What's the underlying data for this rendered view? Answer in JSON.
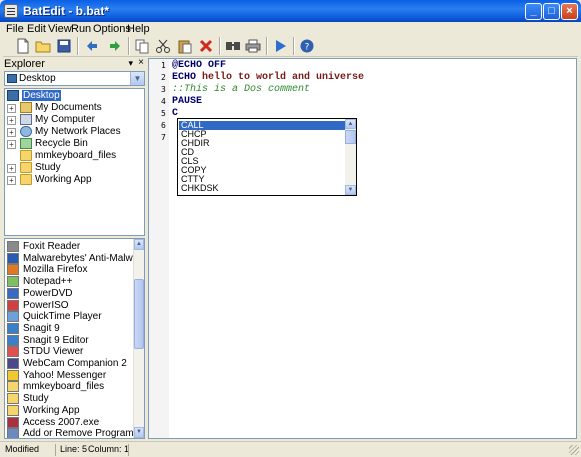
{
  "window": {
    "title": "BatEdit - b.bat*"
  },
  "menu": [
    "File",
    "Edit",
    "View",
    "Run",
    "Options",
    "Help"
  ],
  "toolbar": {
    "buttons": [
      "new-file-icon",
      "open-folder-icon",
      "save-icon",
      "undo-icon",
      "redo-icon",
      "copy-icon",
      "cut-icon",
      "paste-icon",
      "delete-icon",
      "find-icon",
      "print-icon",
      "run-icon",
      "help-icon"
    ]
  },
  "explorer": {
    "title": "Explorer",
    "combo_value": "Desktop",
    "tree": [
      {
        "label": "Desktop",
        "icon": "desktop-icon",
        "expander": "",
        "selected": true
      },
      {
        "label": "My Documents",
        "icon": "my-documents-icon",
        "expander": "+"
      },
      {
        "label": "My Computer",
        "icon": "my-computer-icon",
        "expander": "+"
      },
      {
        "label": "My Network Places",
        "icon": "network-places-icon",
        "expander": "+"
      },
      {
        "label": "Recycle Bin",
        "icon": "recycle-bin-icon",
        "expander": "+"
      },
      {
        "label": "mmkeyboard_files",
        "icon": "folder-icon",
        "expander": ""
      },
      {
        "label": "Study",
        "icon": "folder-icon",
        "expander": "+"
      },
      {
        "label": "Working  App",
        "icon": "folder-icon",
        "expander": "+"
      }
    ],
    "programs": [
      {
        "label": "Foxit Reader",
        "color": "#8a8a8a"
      },
      {
        "label": "Malwarebytes' Anti-Malware",
        "color": "#2a5bb0"
      },
      {
        "label": "Mozilla Firefox",
        "color": "#e07a22"
      },
      {
        "label": "Notepad++",
        "color": "#7fbf5f"
      },
      {
        "label": "PowerDVD",
        "color": "#3a6ac0"
      },
      {
        "label": "PowerISO",
        "color": "#d04040"
      },
      {
        "label": "QuickTime Player",
        "color": "#6fa0d8"
      },
      {
        "label": "Snagit 9",
        "color": "#3a80c8"
      },
      {
        "label": "Snagit 9 Editor",
        "color": "#3a80c8"
      },
      {
        "label": "STDU Viewer",
        "color": "#e05050"
      },
      {
        "label": "WebCam Companion 2",
        "color": "#4a4a8a"
      },
      {
        "label": "Yahoo! Messenger",
        "color": "#f2c830"
      },
      {
        "label": "mmkeyboard_files",
        "color": "#f6d56b"
      },
      {
        "label": "Study",
        "color": "#f6d56b"
      },
      {
        "label": "Working  App",
        "color": "#f6d56b"
      },
      {
        "label": "Access 2007.exe",
        "color": "#a83040"
      },
      {
        "label": "Add or Remove Programs",
        "color": "#6a8ac0"
      }
    ]
  },
  "editor": {
    "lines": [
      {
        "num": "1",
        "text": "@ECHO OFF",
        "style": "kw"
      },
      {
        "num": "2",
        "text": "ECHO hello to world and universe",
        "style": "mixed"
      },
      {
        "num": "3",
        "text": "::This is a Dos comment",
        "style": "cmt"
      },
      {
        "num": "4",
        "text": "PAUSE",
        "style": "kw"
      },
      {
        "num": "5",
        "text": "C",
        "style": "kw"
      },
      {
        "num": "6",
        "text": "",
        "style": "kw"
      },
      {
        "num": "7",
        "text": "",
        "style": "kw"
      }
    ],
    "line2_keyword": "ECHO",
    "line2_rest": " hello to world and universe",
    "autocomplete": {
      "items": [
        "CALL",
        "CHCP",
        "CHDIR",
        "CD",
        "CLS",
        "COPY",
        "CTTY",
        "CHKDSK"
      ],
      "selected": "CALL"
    }
  },
  "status": {
    "state": "Modified",
    "line": "Line: 5",
    "column": "Column: 1"
  },
  "colors": {
    "titlebar": "#0a56d8",
    "selection": "#316ac5",
    "keyword": "#00006b",
    "string": "#7a1a1a",
    "comment": "#2f8a2f"
  }
}
